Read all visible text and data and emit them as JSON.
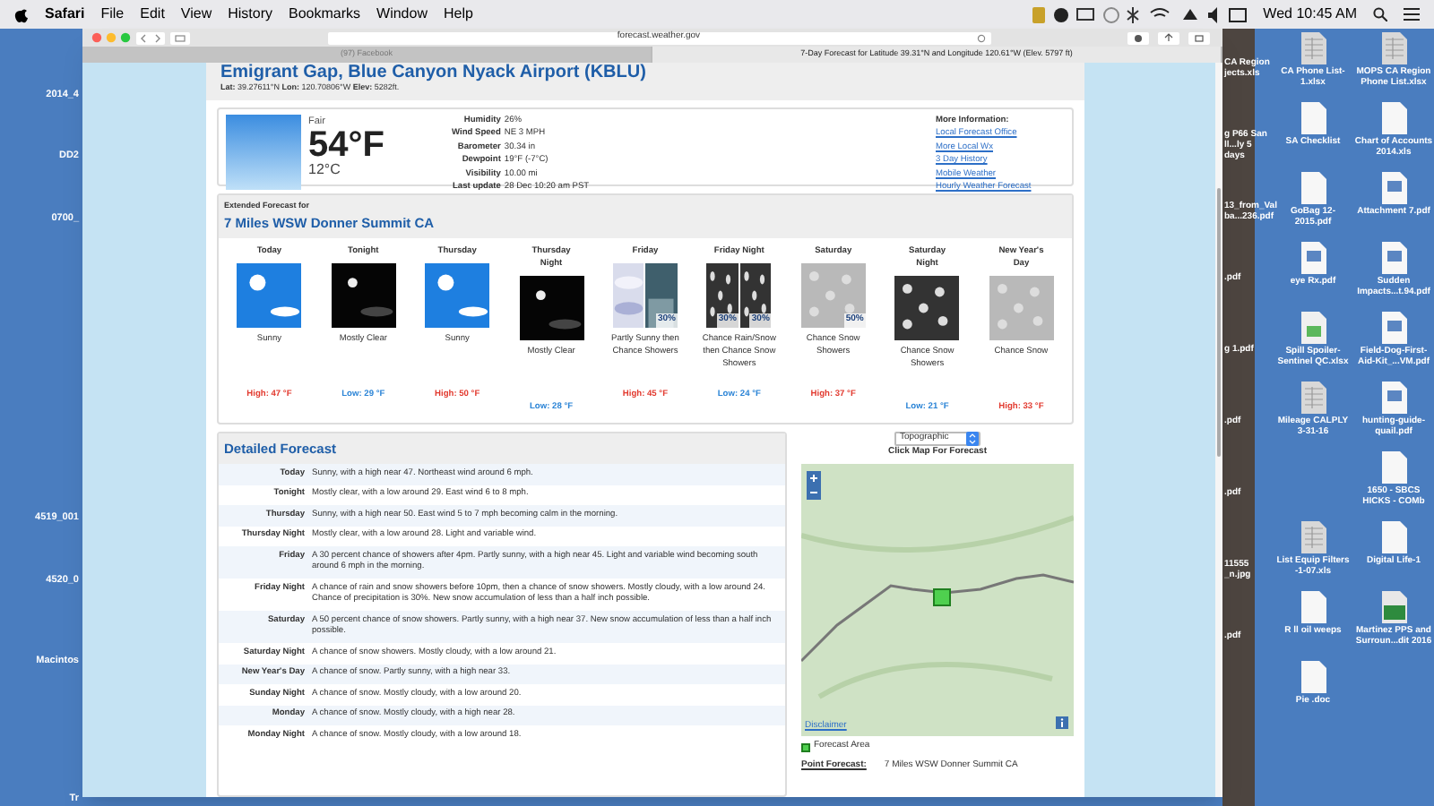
{
  "menubar": {
    "app": "Safari",
    "menus": [
      "File",
      "Edit",
      "View",
      "History",
      "Bookmarks",
      "Window",
      "Help"
    ],
    "clock": "Wed 10:45 AM"
  },
  "browser": {
    "url": "forecast.weather.gov",
    "tabs": [
      {
        "label": "(97) Facebook",
        "selected": false
      },
      {
        "label": "7-Day Forecast for Latitude 39.31°N and Longitude 120.61°W (Elev. 5797 ft)",
        "selected": true
      }
    ]
  },
  "current": {
    "station": "Emigrant Gap, Blue Canyon Nyack Airport (KBLU)",
    "coords": "**Lat:** 39.27611°N  **Lon:** 120.70806°W  **Elev:** 5282ft.",
    "condition": "Fair",
    "temp_f": "54°F",
    "temp_c": "12°C",
    "details": [
      {
        "label": "Humidity",
        "value": "26%"
      },
      {
        "label": "Wind Speed",
        "value": "NE 3 MPH"
      },
      {
        "label": "Barometer",
        "value": "30.34 in"
      },
      {
        "label": "Dewpoint",
        "value": "19°F (-7°C)"
      },
      {
        "label": "Visibility",
        "value": "10.00 mi"
      },
      {
        "label": "Last update",
        "value": "28 Dec 10:20 am PST"
      }
    ],
    "more_info": {
      "title": "More Information:",
      "links": [
        "Local Forecast Office",
        "More Local Wx",
        "3 Day History",
        "Mobile Weather",
        "Hourly Weather Forecast"
      ]
    }
  },
  "extended": {
    "intro": "Extended Forecast for",
    "place": "7 Miles WSW Donner Summit CA",
    "periods": [
      {
        "name": "Today",
        "icon": [
          {
            "kind": "sunny"
          }
        ],
        "summary": "Sunny",
        "kind": "high",
        "temp": "High: 47 °F"
      },
      {
        "name": "Tonight",
        "icon": [
          {
            "kind": "night"
          }
        ],
        "summary": "Mostly Clear",
        "kind": "low",
        "temp": "Low: 29 °F"
      },
      {
        "name": "Thursday",
        "icon": [
          {
            "kind": "sunny"
          }
        ],
        "summary": "Sunny",
        "kind": "high",
        "temp": "High: 50 °F"
      },
      {
        "name": "Thursday Night",
        "icon": [
          {
            "kind": "night"
          }
        ],
        "summary": "Mostly Clear",
        "kind": "low",
        "temp": "Low: 28 °F"
      },
      {
        "name": "Friday",
        "icon": [
          {
            "kind": "clouds"
          },
          {
            "kind": "rain",
            "chance": "30%"
          }
        ],
        "summary": "Partly Sunny then Chance Showers",
        "kind": "high",
        "temp": "High: 45 °F"
      },
      {
        "name": "Friday Night",
        "icon": [
          {
            "kind": "rain_night",
            "chance": "30%"
          },
          {
            "kind": "snow_night",
            "chance": "30%"
          }
        ],
        "summary": "Chance Rain/Snow then Chance Snow Showers",
        "kind": "low",
        "temp": "Low: 24 °F"
      },
      {
        "name": "Saturday",
        "icon": [
          {
            "kind": "snow",
            "chance": "50%"
          }
        ],
        "summary": "Chance Snow Showers",
        "kind": "high",
        "temp": "High: 37 °F"
      },
      {
        "name": "Saturday Night",
        "icon": [
          {
            "kind": "snow_night"
          }
        ],
        "summary": "Chance Snow Showers",
        "kind": "low",
        "temp": "Low: 21 °F"
      },
      {
        "name": "New Year's Day",
        "icon": [
          {
            "kind": "snow"
          }
        ],
        "summary": "Chance Snow",
        "kind": "high",
        "temp": "High: 33 °F"
      }
    ]
  },
  "detailed": {
    "title": "Detailed Forecast",
    "rows": [
      {
        "period": "Today",
        "text": "Sunny, with a high near 47. Northeast wind around 6 mph."
      },
      {
        "period": "Tonight",
        "text": "Mostly clear, with a low around 29. East wind 6 to 8 mph."
      },
      {
        "period": "Thursday",
        "text": "Sunny, with a high near 50. East wind 5 to 7 mph becoming calm in the morning."
      },
      {
        "period": "Thursday Night",
        "text": "Mostly clear, with a low around 28. Light and variable wind."
      },
      {
        "period": "Friday",
        "text": "A 30 percent chance of showers after 4pm. Partly sunny, with a high near 45. Light and variable wind becoming south around 6 mph in the morning."
      },
      {
        "period": "Friday Night",
        "text": "A chance of rain and snow showers before 10pm, then a chance of snow showers. Mostly cloudy, with a low around 24. Chance of precipitation is 30%. New snow accumulation of less than a half inch possible."
      },
      {
        "period": "Saturday",
        "text": "A 50 percent chance of snow showers. Partly sunny, with a high near 37. New snow accumulation of less than a half inch possible."
      },
      {
        "period": "Saturday Night",
        "text": "A chance of snow showers. Mostly cloudy, with a low around 21."
      },
      {
        "period": "New Year's Day",
        "text": "A chance of snow. Partly sunny, with a high near 33."
      },
      {
        "period": "Sunday Night",
        "text": "A chance of snow. Mostly cloudy, with a low around 20."
      },
      {
        "period": "Monday",
        "text": "A chance of snow. Mostly cloudy, with a high near 28."
      },
      {
        "period": "Monday Night",
        "text": "A chance of snow. Mostly cloudy, with a low around 18."
      }
    ]
  },
  "map": {
    "layer": "Topographic",
    "caption": "Click Map For Forecast",
    "disclaimer": "Disclaimer",
    "legend": "Forecast Area",
    "point_label": "Point Forecast:",
    "point_value": "7 Miles WSW Donner Summit CA"
  },
  "desktop_left": [
    "2014_4",
    "DD2",
    "0700_",
    "4519_001",
    "4520_0",
    "Macintos",
    "Tr"
  ],
  "desktop_partial": [
    "CA Region jects.xls",
    "g P66 San ll...ly 5 days",
    "13_from_Val ba...236.pdf",
    ".pdf",
    "g 1.pdf",
    ".pdf",
    ".pdf",
    "11555 _n.jpg",
    ".pdf"
  ],
  "desktop_icons": [
    {
      "kind": "sheet",
      "label": "CA Phone List-1.xlsx"
    },
    {
      "kind": "sheet",
      "label": "MOPS CA Region Phone List.xlsx"
    },
    {
      "kind": "doc",
      "label": "SA Checklist"
    },
    {
      "kind": "doc",
      "label": "Chart of Accounts 2014.xls"
    },
    {
      "kind": "doc",
      "label": "GoBag 12-2015.pdf"
    },
    {
      "kind": "pdf",
      "label": "Attachment 7.pdf"
    },
    {
      "kind": "pdf",
      "label": "eye Rx.pdf"
    },
    {
      "kind": "pdf",
      "label": "Sudden Impacts...t.94.pdf"
    },
    {
      "kind": "xlsx",
      "label": "Spill Spoiler-Sentinel QC.xlsx"
    },
    {
      "kind": "pdf",
      "label": "Field-Dog-First-Aid-Kit_...VM.pdf"
    },
    {
      "kind": "sheet",
      "label": "Mileage CALPLY 3-31-16"
    },
    {
      "kind": "pdf",
      "label": "hunting-guide-quail.pdf"
    },
    {
      "kind": "none"
    },
    {
      "kind": "doc",
      "label": "1650 - SBCS HICKS - COMb"
    },
    {
      "kind": "sheet",
      "label": "List Equip Filters -1-07.xls"
    },
    {
      "kind": "doc",
      "label": "Digital Life-1"
    },
    {
      "kind": "doc",
      "label": "R ll oil weeps"
    },
    {
      "kind": "image",
      "label": "Martinez PPS and Surroun...dit 2016"
    },
    {
      "kind": "doc",
      "label": "Pie .doc"
    }
  ]
}
